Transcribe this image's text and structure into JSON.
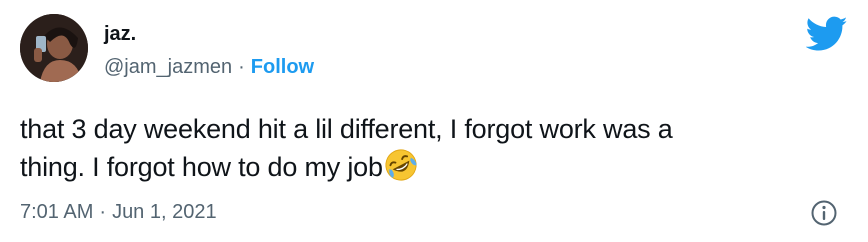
{
  "author": {
    "display_name": "jaz.",
    "handle": "@jam_jazmen",
    "separator": "·",
    "follow_label": "Follow"
  },
  "tweet": {
    "line1": "that 3 day weekend hit a lil different, I forgot work was a",
    "line2": "thing. I forgot how to do my job",
    "emoji": "rolling-on-the-floor-laughing-emoji"
  },
  "meta": {
    "time": "7:01 AM",
    "separator": "·",
    "date": "Jun 1, 2021"
  },
  "icons": {
    "logo": "twitter-bird-icon",
    "info": "info-icon"
  },
  "colors": {
    "brand_blue": "#1d9bf0",
    "text_primary": "#0f1419",
    "text_secondary": "#536471",
    "emoji_yellow": "#f7c531"
  }
}
